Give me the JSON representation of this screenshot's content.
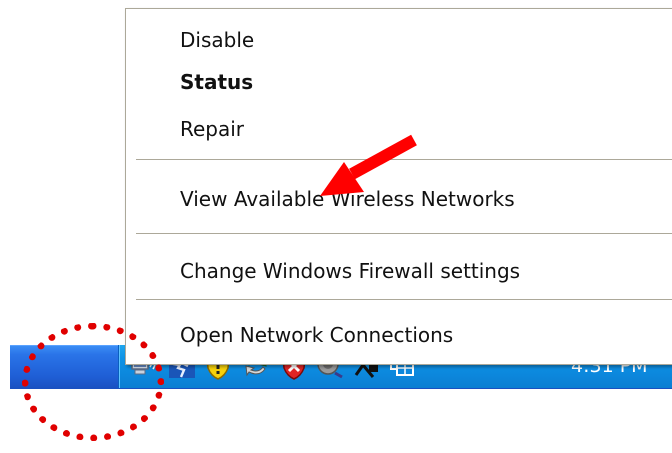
{
  "context_menu": {
    "items": [
      {
        "label": "Disable",
        "bold": false
      },
      {
        "label": "Status",
        "bold": true
      },
      {
        "label": "Repair",
        "bold": false
      },
      {
        "label": "View Available Wireless Networks",
        "bold": false
      },
      {
        "label": "Change Windows Firewall settings",
        "bold": false
      },
      {
        "label": "Open Network Connections",
        "bold": false
      }
    ]
  },
  "taskbar": {
    "clock": "4:31 PM",
    "tray_icons": [
      "wireless-network-icon",
      "running-man-icon",
      "security-shield-icon",
      "sync-icon",
      "security-alert-icon",
      "speaker-icon",
      "network-tool-icon",
      "windows-icon"
    ]
  },
  "annotation": {
    "arrow_color": "#ff0000",
    "circle_color": "#e00000"
  }
}
